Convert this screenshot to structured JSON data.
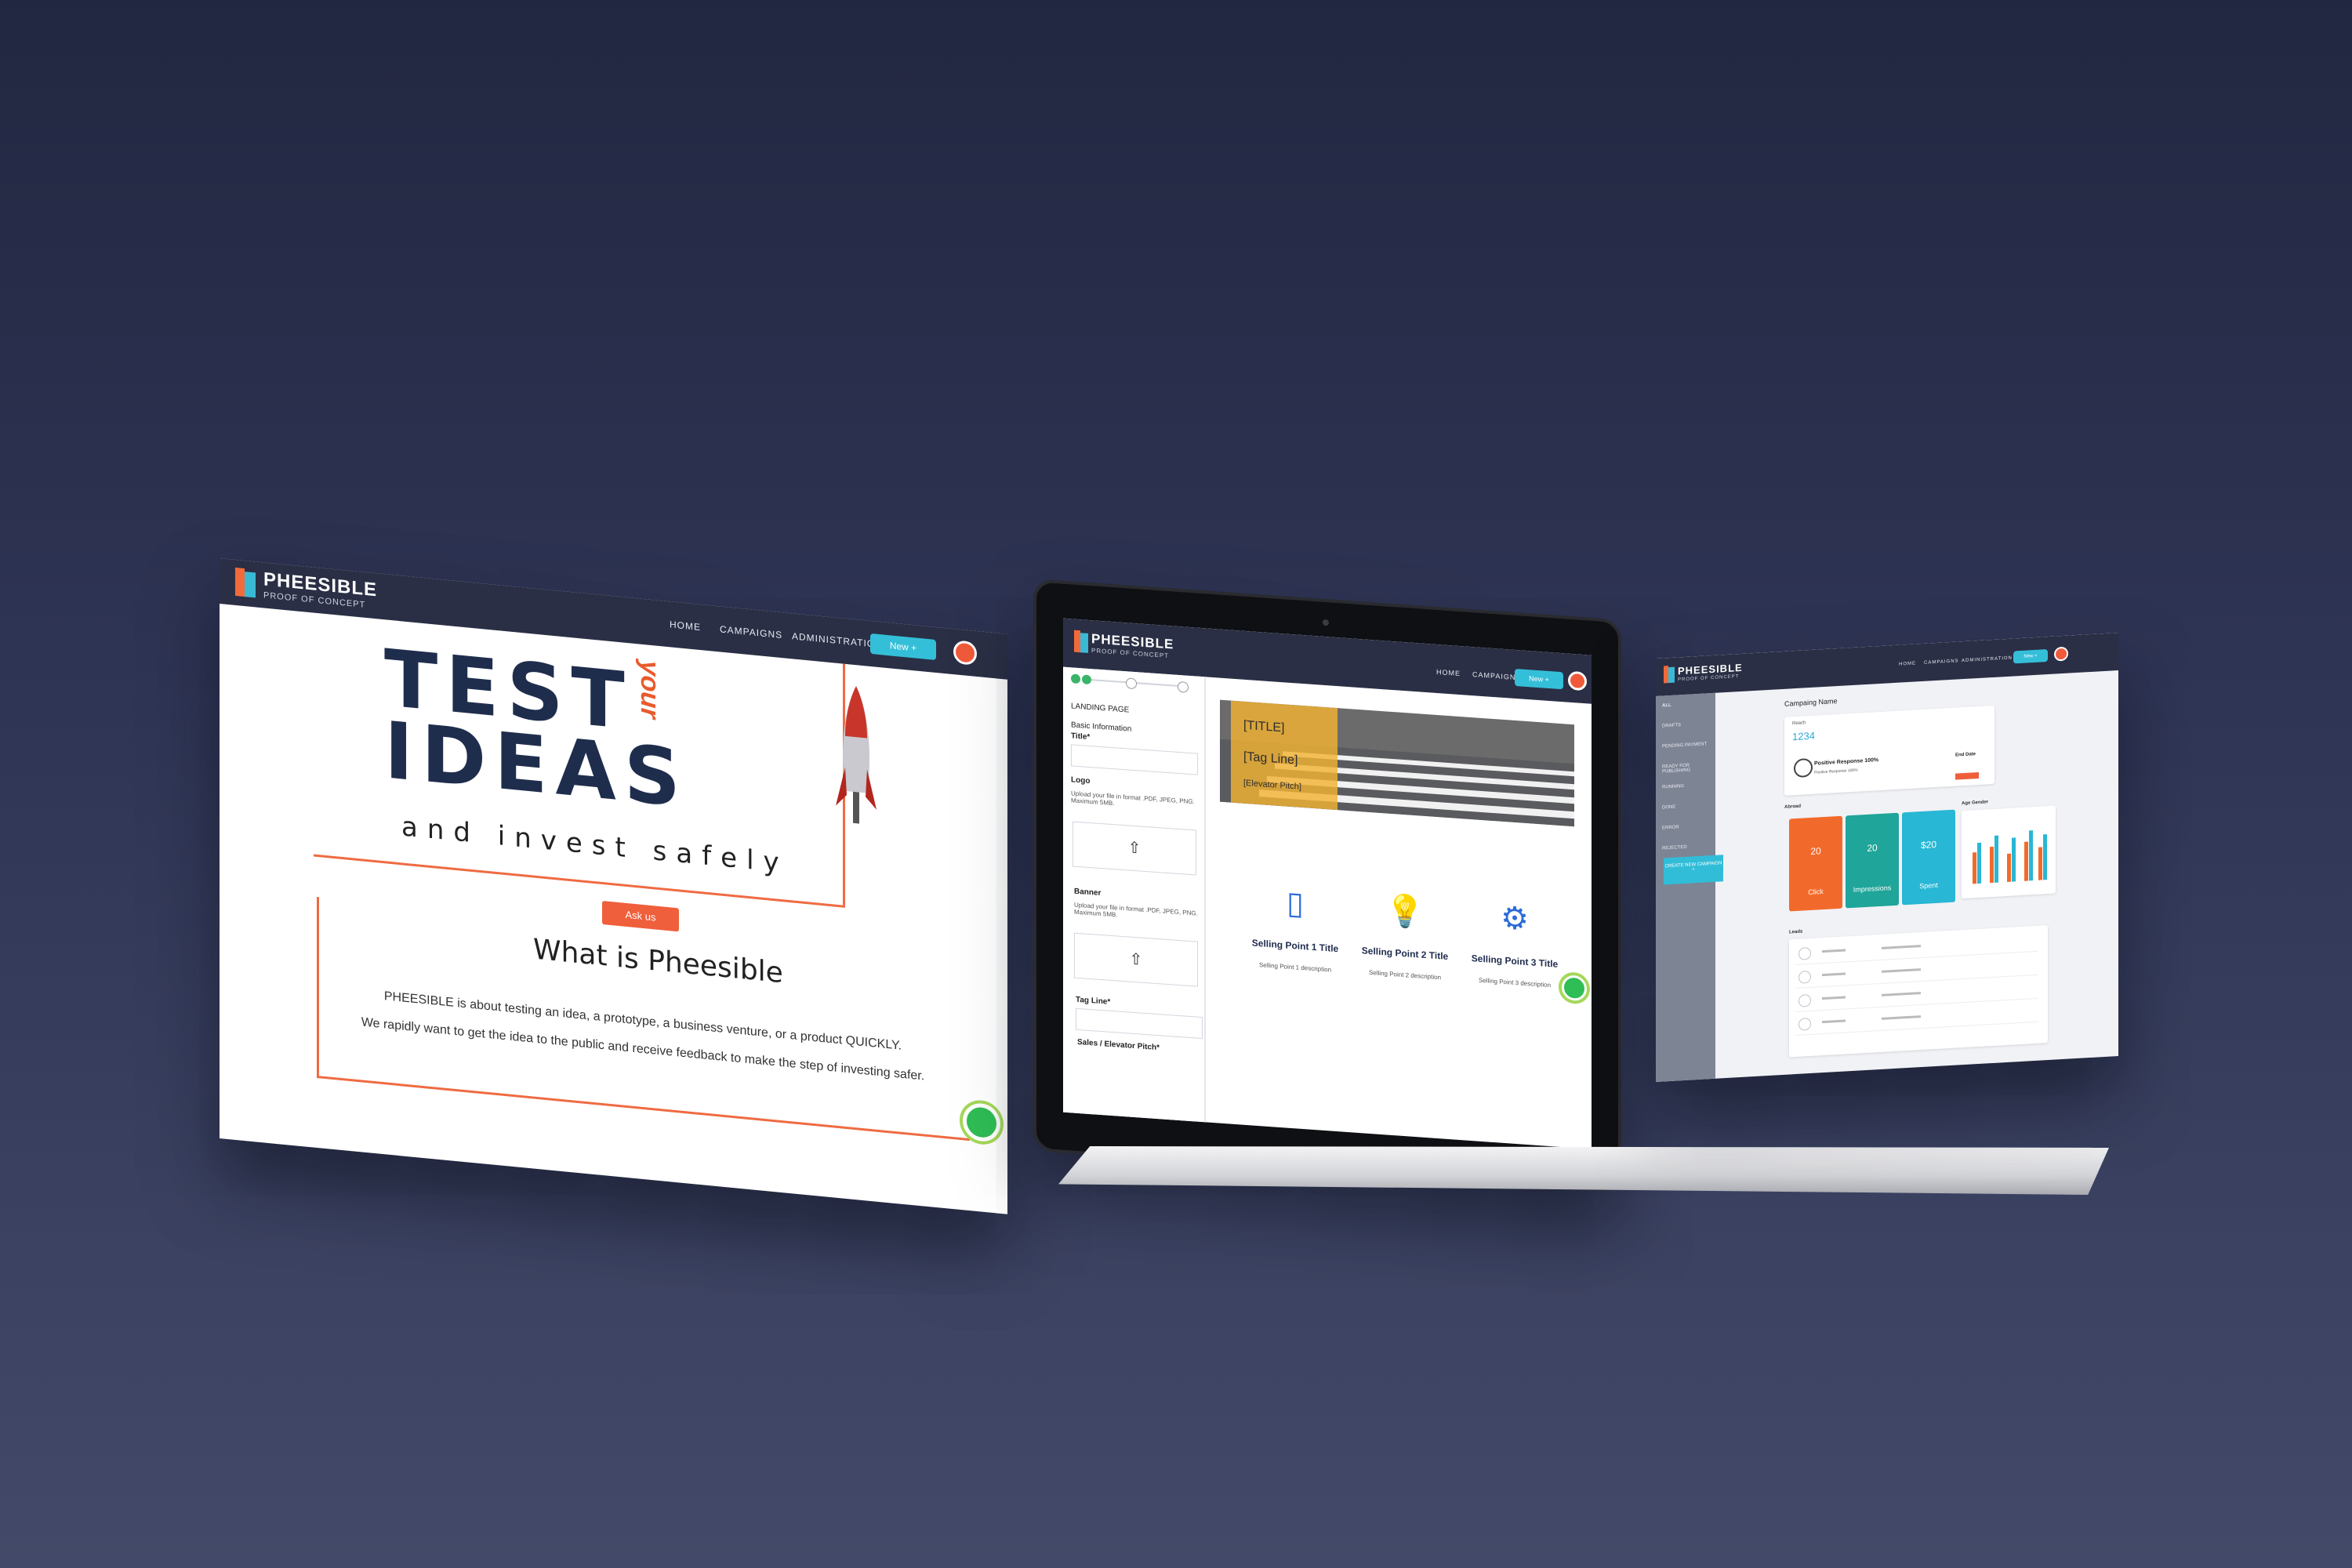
{
  "brand": {
    "name": "PHEESIBLE",
    "tagline": "PROOF OF CONCEPT",
    "colors": {
      "orange": "#ef5f3b",
      "cyan": "#34bfd9",
      "navy": "#1f2d4d",
      "navbar": "#2a2f45"
    }
  },
  "nav": {
    "home": "HOME",
    "campaigns": "CAMPAIGNS",
    "administration": "ADMINISTRATION",
    "new_button": "New +"
  },
  "landing": {
    "hero_line1": "TEST",
    "hero_accent": "your",
    "hero_line2": "IDEAS",
    "subtitle": "and invest safely",
    "cta": "Ask us",
    "section_title": "What is Pheesible",
    "para1": "PHEESIBLE is about testing an idea, a prototype, a business venture, or a product QUICKLY.",
    "para2": "We rapidly want to get the idea to the public and receive feedback to make the step of investing safer."
  },
  "editor": {
    "section": "LANDING PAGE",
    "basic_info": "Basic Information",
    "title_label": "Title*",
    "logo_label": "Logo",
    "logo_help": "Upload your file in format .PDF, JPEG, PNG. Maximum 5MB.",
    "banner_label": "Banner",
    "banner_help": "Upload your file in format .PDF, JPEG, PNG. Maximum 5MB.",
    "tagline_label": "Tag Line*",
    "pitch_label": "Sales / Elevator Pitch*",
    "preview_title": "[TITLE]",
    "preview_tagline": "[Tag Line]",
    "preview_pitch": "[Elevator Pitch]",
    "selling_points": [
      {
        "title": "Selling Point 1 Title",
        "desc": "Selling Point 1 description",
        "icon": "phone-icon"
      },
      {
        "title": "Selling Point 2 Title",
        "desc": "Selling Point 2 description",
        "icon": "lightbulb-icon"
      },
      {
        "title": "Selling Point 3 Title",
        "desc": "Selling Point 3 description",
        "icon": "gears-icon"
      }
    ]
  },
  "dashboard": {
    "sidebar_items": [
      "ALL",
      "DRAFTS",
      "PENDING PAYMENT",
      "READY FOR PUBLISHING",
      "RUNNING",
      "DONE",
      "ERROR",
      "REJECTED"
    ],
    "create_button": "CREATE NEW CAMPAIGN +",
    "campaign_name": "Campaing Name",
    "reach_label": "Reach",
    "reach_value": "1234",
    "positive_response": "Positive Response 100%",
    "positive_sub": "Positive Response 100%",
    "end_date": "End Date",
    "abroad_label": "Abroad",
    "age_gender_label": "Age Gender",
    "tiles": [
      {
        "value": "20",
        "label": "Click",
        "color": "#f26a2b"
      },
      {
        "value": "20",
        "label": "Impressions",
        "color": "#1fa59a"
      },
      {
        "value": "$20",
        "label": "Spent",
        "color": "#28b7d4"
      }
    ],
    "leads_label": "Leads"
  }
}
